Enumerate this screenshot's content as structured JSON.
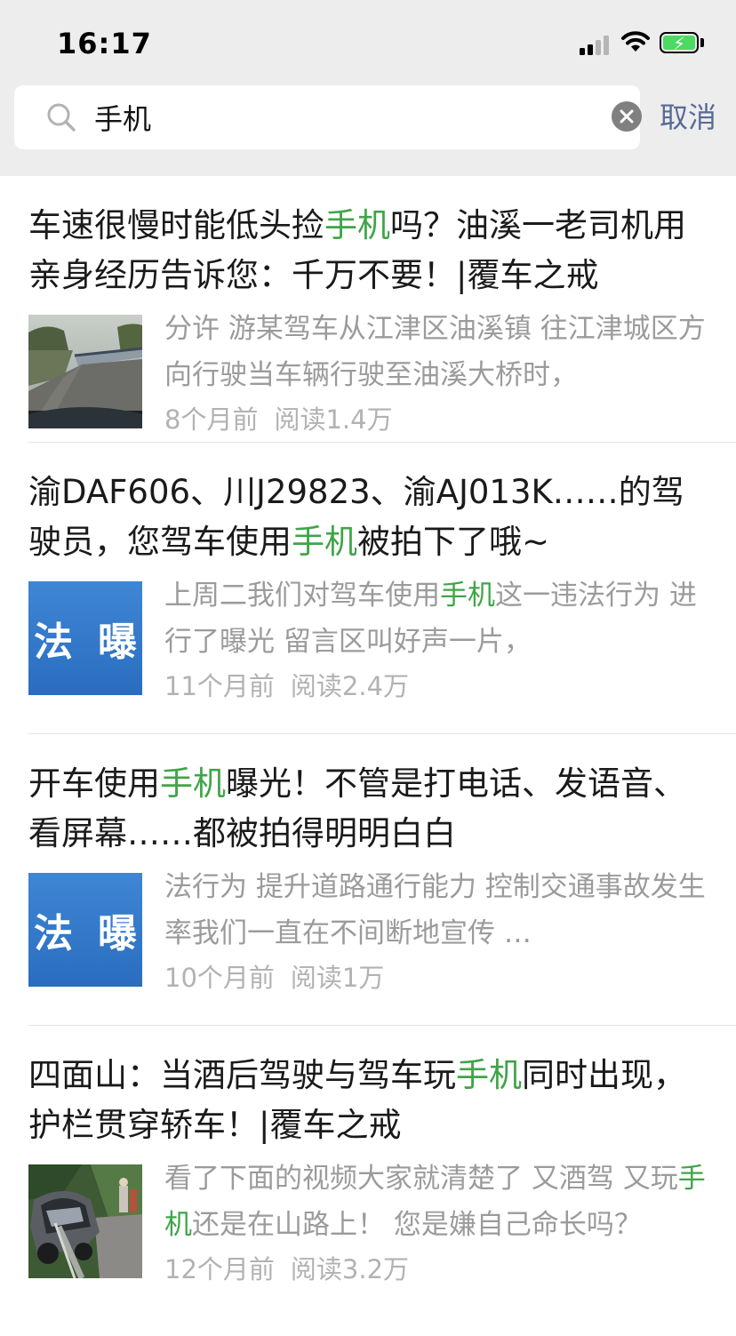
{
  "status": {
    "time": "16:17"
  },
  "search": {
    "query": "手机",
    "cancel_label": "取消"
  },
  "results": [
    {
      "title_pre": "车速很慢时能低头捡",
      "title_hl": "手机",
      "title_post": "吗？油溪一老司机用亲身经历告诉您：千万不要！|覆车之戒",
      "digest_pre": "分许 游某驾车从江津区油溪镇 往江津城区方向行驶当车辆行驶至油溪大桥时，",
      "digest_hl": "",
      "digest_post": "",
      "time_ago": "8个月前",
      "reads": "阅读1.4万",
      "thumb": "road-photo"
    },
    {
      "title_pre": "渝DAF606、川J29823、渝AJ013K……的驾驶员，您驾车使用",
      "title_hl": "手机",
      "title_post": "被拍下了哦~",
      "digest_pre": "上周二我们对驾车使用",
      "digest_hl": "手机",
      "digest_post": "这一违法行为 进行了曝光 留言区叫好声一片，",
      "time_ago": "11个月前",
      "reads": "阅读2.4万",
      "thumb_left": "法",
      "thumb_right": "曝"
    },
    {
      "title_pre": "开车使用",
      "title_hl": "手机",
      "title_post": "曝光！不管是打电话、发语音、看屏幕……都被拍得明明白白",
      "digest_pre": "法行为 提升道路通行能力 控制交通事故发生率我们一直在不间断地宣传 …",
      "digest_hl": "",
      "digest_post": "",
      "time_ago": "10个月前",
      "reads": "阅读1万",
      "thumb_left": "法",
      "thumb_right": "曝"
    },
    {
      "title_pre": "四面山：当酒后驾驶与驾车玩",
      "title_hl": "手机",
      "title_post": "同时出现，护栏贯穿轿车！|覆车之戒",
      "digest_pre": "看了下面的视频大家就清楚了 又酒驾 又玩",
      "digest_hl": "手机",
      "digest_post": "还是在山路上！ 您是嫌自己命长吗？",
      "time_ago": "12个月前",
      "reads": "阅读3.2万",
      "thumb": "crash-photo"
    }
  ],
  "colors": {
    "highlight": "#3fa548",
    "link": "#576b95",
    "meta": "#b2b2b2"
  }
}
